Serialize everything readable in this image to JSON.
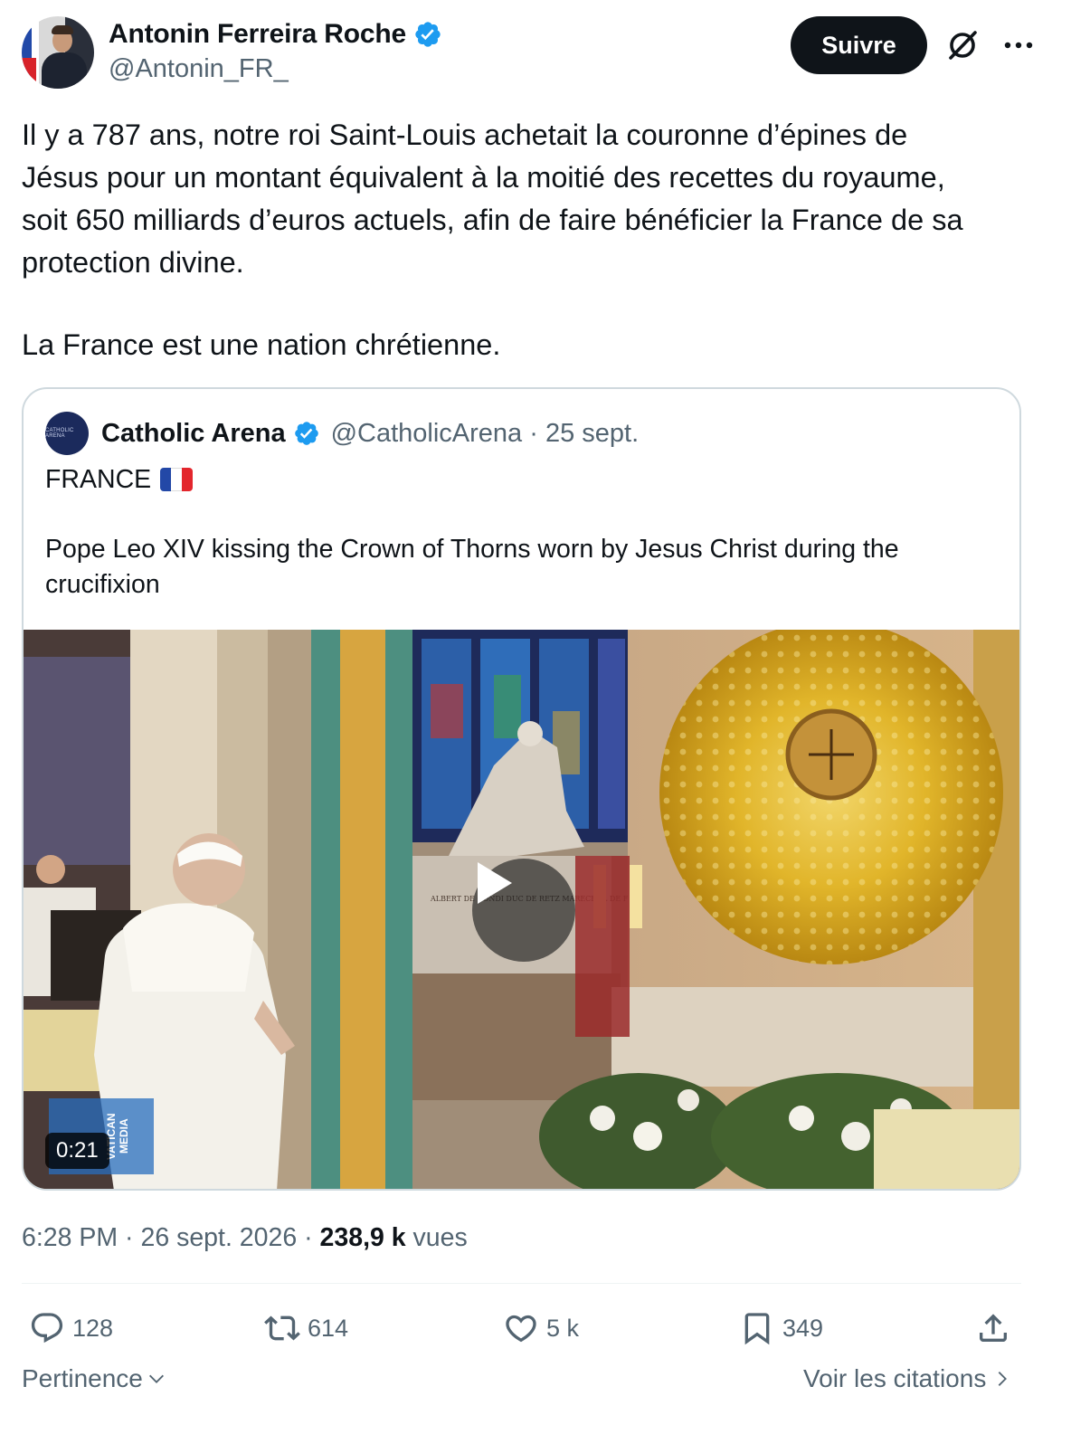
{
  "author": {
    "name": "Antonin Ferreira Roche",
    "handle": "@Antonin_FR_",
    "follow_label": "Suivre"
  },
  "tweet": {
    "text": "Il y a 787 ans, notre roi Saint-Louis achetait la couronne d’épines de\nJésus pour un montant équivalent à la moitié des recettes du royaume,\nsoit 650 milliards d’euros actuels, afin de faire bénéficier la France de sa\nprotection divine.",
    "text2": "La France est une nation chrétienne."
  },
  "quoted": {
    "avatar_text": "CATHOLIC ARENA",
    "name": "Catholic Arena",
    "handle": "@CatholicArena · 25 sept.",
    "line1": "FRANCE",
    "line2": "Pope Leo XIV kissing the Crown of Thorns worn by Jesus Christ during the crucifixion",
    "duration": "0:21",
    "watermark": "VATICAN MEDIA",
    "statue_inscription": "ALBERT DE GONDI DUC DE RETZ MARECHAL DE FRANCE 1598-1602"
  },
  "meta": {
    "time_date": "6:28 PM · 26 sept. 2026 · ",
    "views_count": "238,9 k",
    "views_label": " vues"
  },
  "actions": {
    "replies": "128",
    "reposts": "614",
    "likes": "5 k",
    "bookmarks": "349"
  },
  "footer": {
    "sort_label": "Pertinence",
    "quotes_label": "Voir les citations"
  },
  "colors": {
    "text": "#0f1419",
    "secondary": "#536471",
    "verified_blue": "#1d9bf0",
    "border": "#cfd9de"
  },
  "icons": [
    "verified-badge-icon",
    "grok-icon",
    "more-icon",
    "play-icon",
    "reply-icon",
    "repost-icon",
    "like-icon",
    "bookmark-icon",
    "share-icon",
    "chevron-down-icon",
    "chevron-right-icon"
  ]
}
